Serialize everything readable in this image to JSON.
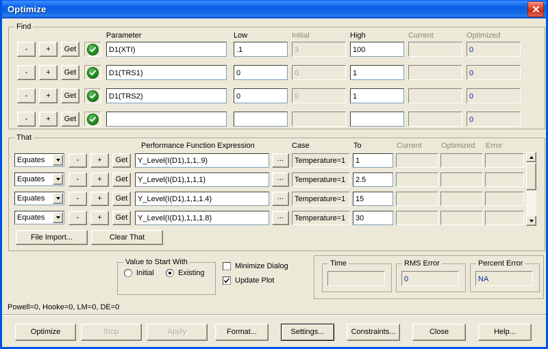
{
  "window": {
    "title": "Optimize",
    "close_icon": "close-icon"
  },
  "find": {
    "legend": "Find",
    "columns": {
      "parameter": "Parameter",
      "low": "Low",
      "initial": "Initial",
      "high": "High",
      "current": "Current",
      "optimized": "Optimized"
    },
    "row_buttons": {
      "minus": "-",
      "plus": "+",
      "get": "Get"
    },
    "rows": [
      {
        "enabled": true,
        "parameter": "D1(XTI)",
        "low": ".1",
        "initial": "3",
        "high": "100",
        "current": "",
        "optimized": "0"
      },
      {
        "enabled": true,
        "parameter": "D1(TRS1)",
        "low": "0",
        "initial": "0",
        "high": "1",
        "current": "",
        "optimized": "0"
      },
      {
        "enabled": true,
        "parameter": "D1(TRS2)",
        "low": "0",
        "initial": "0",
        "high": "1",
        "current": "",
        "optimized": "0"
      },
      {
        "enabled": true,
        "parameter": "",
        "low": "",
        "initial": "",
        "high": "",
        "current": "",
        "optimized": "0"
      }
    ]
  },
  "that": {
    "legend": "That",
    "columns": {
      "expression": "Performance Function Expression",
      "case": "Case",
      "to": "To",
      "current": "Current",
      "optimized": "Optimized",
      "error": "Error"
    },
    "row_buttons": {
      "minus": "-",
      "plus": "+",
      "get": "Get",
      "ellipsis": "..."
    },
    "rows": [
      {
        "op": "Equates",
        "expression": "Y_Level(I(D1),1,1,.9)",
        "case": "Temperature=1",
        "to": "1",
        "current": "",
        "optimized": "",
        "error": ""
      },
      {
        "op": "Equates",
        "expression": "Y_Level(I(D1),1,1,1)",
        "case": "Temperature=1",
        "to": "2.5",
        "current": "",
        "optimized": "",
        "error": ""
      },
      {
        "op": "Equates",
        "expression": "Y_Level(I(D1),1,1,1.4)",
        "case": "Temperature=1",
        "to": "15",
        "current": "",
        "optimized": "",
        "error": ""
      },
      {
        "op": "Equates",
        "expression": "Y_Level(I(D1),1,1,1.8)",
        "case": "Temperature=1",
        "to": "30",
        "current": "",
        "optimized": "",
        "error": ""
      }
    ],
    "file_import_label": "File Import...",
    "clear_that_label": "Clear That"
  },
  "options": {
    "value_to_start_with": {
      "legend": "Value to Start With",
      "initial_label": "Initial",
      "existing_label": "Existing",
      "selected": "Existing"
    },
    "minimize_dialog": {
      "label": "Minimize Dialog",
      "checked": false
    },
    "update_plot": {
      "label": "Update Plot",
      "checked": true
    }
  },
  "results": {
    "time": {
      "legend": "Time",
      "value": ""
    },
    "rms_error": {
      "legend": "RMS Error",
      "value": "0"
    },
    "percent_error": {
      "legend": "Percent Error",
      "value": "NA"
    }
  },
  "status": "Powell=0, Hooke=0, LM=0, DE=0",
  "buttons": {
    "optimize": "Optimize",
    "stop": "Stop",
    "apply": "Apply",
    "format": "Format...",
    "settings": "Settings...",
    "constraints": "Constraints...",
    "close": "Close",
    "help": "Help..."
  }
}
